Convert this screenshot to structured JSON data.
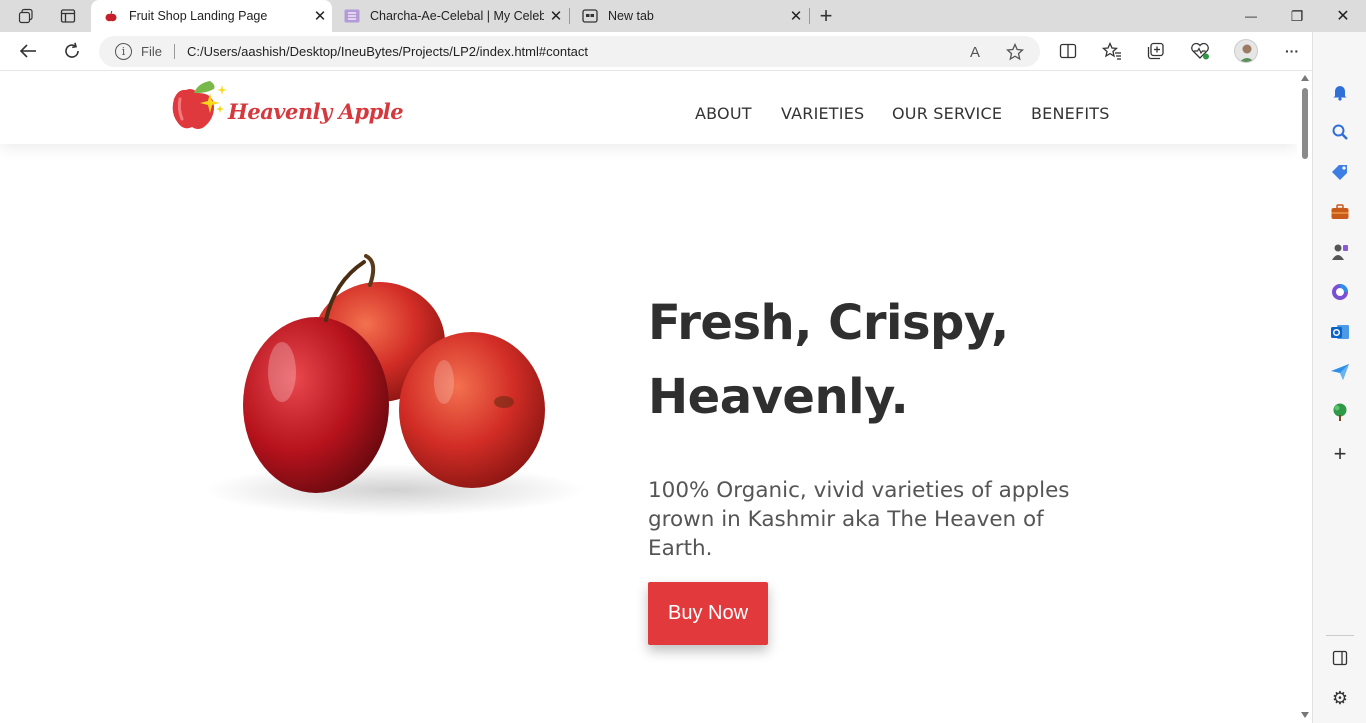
{
  "browser": {
    "tabs": [
      {
        "title": "Fruit Shop Landing Page",
        "icon": "apple-favicon-icon",
        "active": true
      },
      {
        "title": "Charcha-Ae-Celebal | My Celebal",
        "icon": "list-favicon-icon",
        "active": false
      },
      {
        "title": "New tab",
        "icon": "newtab-favicon-icon",
        "active": false
      }
    ],
    "close_glyph": "✕",
    "new_tab_glyph": "+",
    "window": {
      "minimize": "—",
      "restore": "❐",
      "close": "✕"
    },
    "address": {
      "scheme_label": "File",
      "info_glyph": "i",
      "url": "C:/Users/aashish/Desktop/IneuBytes/Projects/LP2/index.html#contact"
    },
    "toolbar_icons": [
      "back-icon",
      "refresh-icon",
      "read-aloud-icon",
      "favorite-star-icon",
      "split-screen-icon",
      "favorites-icon",
      "collections-icon",
      "browser-essentials-icon",
      "profile-icon",
      "more-icon",
      "copilot-icon"
    ],
    "read_aloud_glyph": "A",
    "more_glyph": "···",
    "sidebar_icons": [
      "notifications-icon",
      "search-icon",
      "shopping-tag-icon",
      "tools-icon",
      "games-icon",
      "microsoft365-icon",
      "outlook-icon",
      "send-icon",
      "tree-icon",
      "add-icon",
      "sidebar-toggle-icon",
      "settings-icon"
    ],
    "add_glyph": "+",
    "settings_glyph": "⚙"
  },
  "site": {
    "logo_text": "Heavenly Apple",
    "nav": [
      "ABOUT",
      "VARIETIES",
      "OUR SERVICE",
      "BENEFITS"
    ],
    "hero": {
      "title_line1": "Fresh, Crispy,",
      "title_line2": "Heavenly.",
      "subtitle": "100% Organic, vivid varieties of apples grown in Kashmir aka The Heaven of Earth.",
      "cta": "Buy Now"
    }
  },
  "colors": {
    "brand_red": "#d5393e",
    "button_red": "#e2393c",
    "text_dark": "#2f2f2f",
    "tabstrip": "#dcdcdc"
  }
}
